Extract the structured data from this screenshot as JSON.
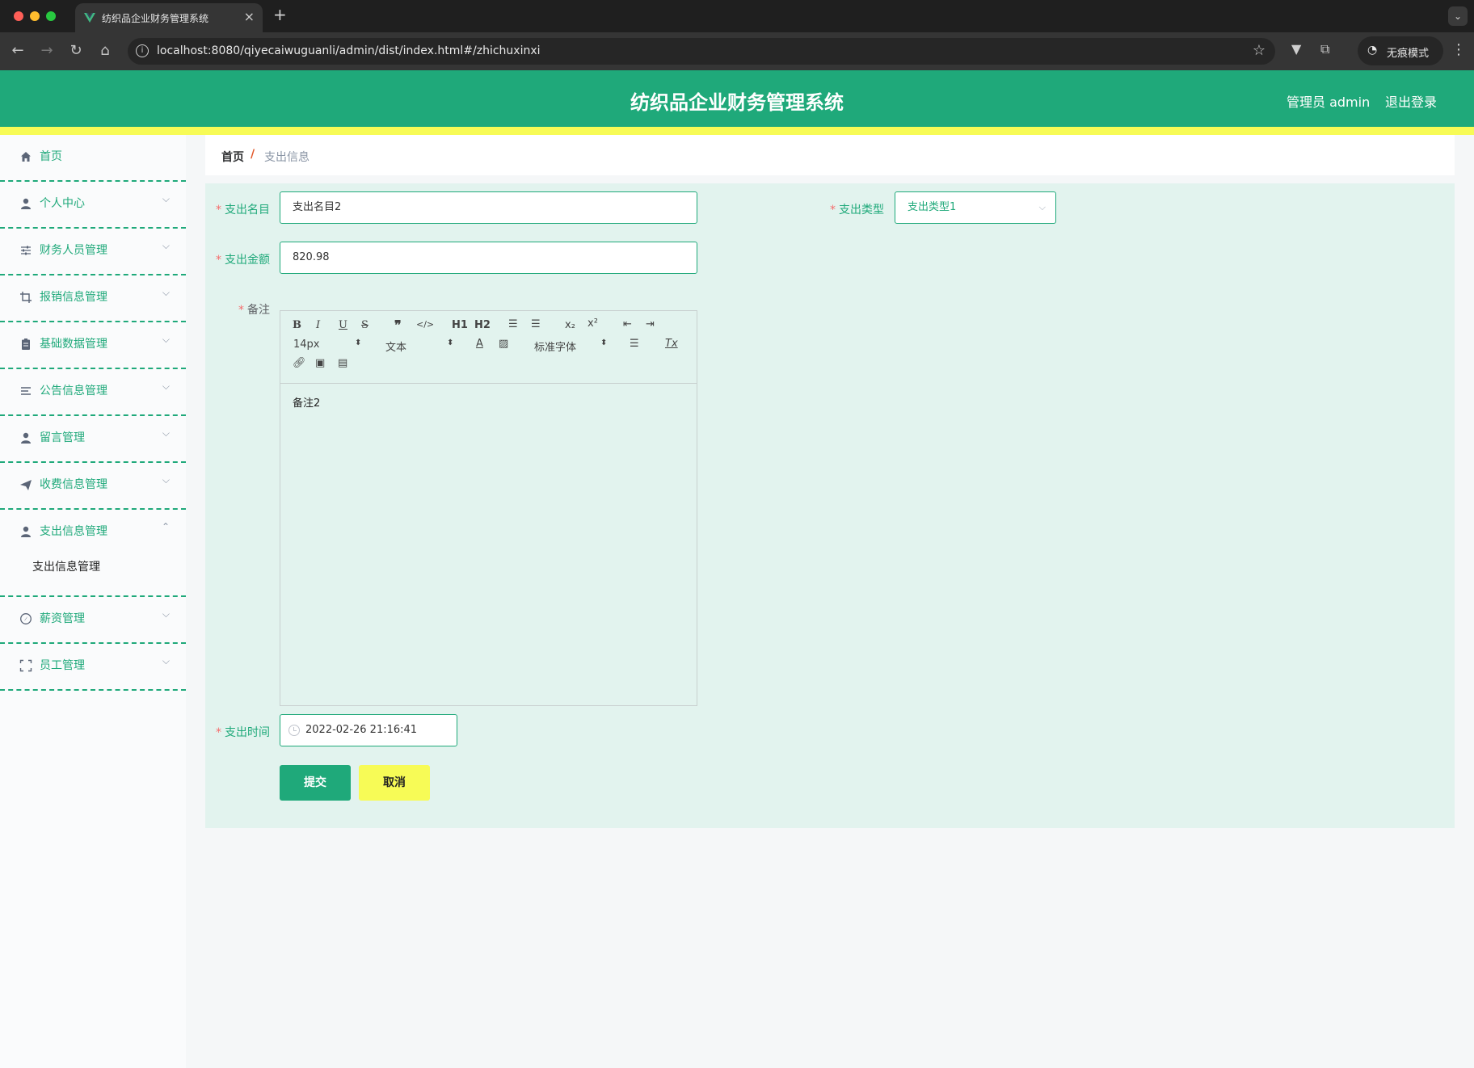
{
  "browser": {
    "tab_title": "纺织品企业财务管理系统",
    "url": "localhost:8080/qiyecaiwuguanli/admin/dist/index.html#/zhichuxinxi",
    "incognito_label": "无痕模式"
  },
  "header": {
    "title": "纺织品企业财务管理系统",
    "user_label": "管理员 admin",
    "logout_label": "退出登录"
  },
  "sidebar": {
    "items": [
      {
        "label": "首页",
        "icon": "home-icon"
      },
      {
        "label": "个人中心",
        "icon": "user-icon"
      },
      {
        "label": "财务人员管理",
        "icon": "sliders-icon"
      },
      {
        "label": "报销信息管理",
        "icon": "crop-icon"
      },
      {
        "label": "基础数据管理",
        "icon": "clipboard-icon"
      },
      {
        "label": "公告信息管理",
        "icon": "list-icon"
      },
      {
        "label": "留言管理",
        "icon": "user-icon"
      },
      {
        "label": "收费信息管理",
        "icon": "send-icon"
      },
      {
        "label": "支出信息管理",
        "icon": "user-icon"
      },
      {
        "label": "薪资管理",
        "icon": "compass-icon"
      },
      {
        "label": "员工管理",
        "icon": "fullscreen-icon"
      }
    ],
    "submenu_label": "支出信息管理"
  },
  "breadcrumb": {
    "home": "首页",
    "separator": "/",
    "current": "支出信息"
  },
  "form": {
    "name_label": "支出名目",
    "name_value": "支出名目2",
    "type_label": "支出类型",
    "type_value": "支出类型1",
    "amount_label": "支出金额",
    "amount_value": "820.98",
    "note_label": "备注",
    "note_content": "备注2",
    "time_label": "支出时间",
    "time_value": "2022-02-26 21:16:41",
    "required_mark": "*",
    "submit_label": "提交",
    "cancel_label": "取消"
  },
  "editor_toolbar": {
    "font_size": "14px",
    "header_select": "文本",
    "font_family": "标准字体",
    "h1": "H1",
    "h2": "H2"
  },
  "colors": {
    "primary": "#1fa97a",
    "accent_yellow": "#f7fb56",
    "required": "#f56c6c"
  }
}
